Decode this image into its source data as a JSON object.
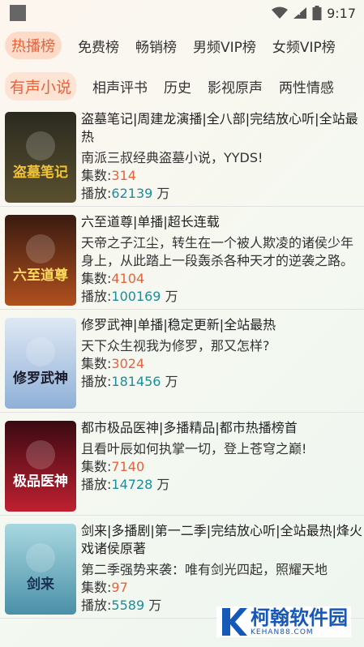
{
  "status": {
    "time": "9:17"
  },
  "tabs_row1": [
    "热播榜",
    "免费榜",
    "畅销榜",
    "男频VIP榜",
    "女频VIP榜"
  ],
  "tabs_row2": [
    "有声小说",
    "相声评书",
    "历史",
    "影视原声",
    "两性情感"
  ],
  "labels": {
    "episodes": "集数:",
    "plays": "播放:",
    "plays_unit": " 万"
  },
  "books": [
    {
      "title": "盗墓笔记|周建龙演播|全八部|完结放心听|全站最热",
      "desc": "南派三叔经典盗墓小说，YYDS!",
      "episodes": "314",
      "plays": "62139",
      "cover_text": "盗墓笔记",
      "cover_colors": [
        "#2a2a1f",
        "#5a5030"
      ],
      "text_color": "#f2c230"
    },
    {
      "title": "六至道尊|单播|超长连载",
      "desc": "天帝之子江尘，转生在一个被人欺凌的诸侯少年身上，从此踏上一段轰杀各种天才的逆袭之路。",
      "episodes": "4104",
      "plays": "100169",
      "cover_text": "六至道尊",
      "cover_colors": [
        "#3a1a10",
        "#b0501e"
      ],
      "text_color": "#ffd860"
    },
    {
      "title": "修罗武神|单播|稳定更新|全站最热",
      "desc": "天下众生视我为修罗，那又怎样?",
      "episodes": "3024",
      "plays": "181456",
      "cover_text": "修罗武神",
      "cover_colors": [
        "#dfe8f4",
        "#8fb0d8"
      ],
      "text_color": "#1a1a2a"
    },
    {
      "title": "都市极品医神|多播精品|都市热播榜首",
      "desc": "且看叶辰如何执掌一切，登上苍穹之巅!",
      "episodes": "7140",
      "plays": "14728",
      "cover_text": "极品医神",
      "cover_colors": [
        "#3a0a12",
        "#c02030"
      ],
      "text_color": "#ffffff"
    },
    {
      "title": "剑来|多播剧|第一二季|完结放心听|全站最热|烽火戏诸侯原著",
      "desc": "第二季强势来袭：唯有剑光四起，照耀天地",
      "episodes": "97",
      "plays": "5589",
      "cover_text": "剑来",
      "cover_colors": [
        "#a8d8e0",
        "#4a90a8"
      ],
      "text_color": "#1a3050"
    }
  ],
  "watermark": {
    "cn": "柯翰软件园",
    "en": "KEHAN88.COM"
  }
}
